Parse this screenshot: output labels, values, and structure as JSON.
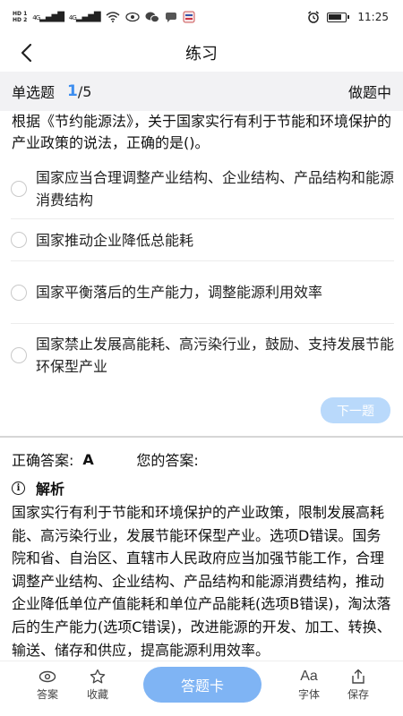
{
  "status_bar": {
    "sim1": "HD 1",
    "sim2": "HD 2",
    "signal1": "4G",
    "signal2": "4G",
    "time": "11:25"
  },
  "nav": {
    "title": "练习"
  },
  "question_header": {
    "type": "单选题",
    "current": "1",
    "total": "/5",
    "status": "做题中"
  },
  "question": {
    "text": "根据《节约能源法》，关于国家实行有利于节能和环境保护的产业政策的说法，正确的是()。",
    "options": [
      {
        "text": "国家应当合理调整产业结构、企业结构、产品结构和能源消费结构"
      },
      {
        "text": "国家推动企业降低总能耗"
      },
      {
        "text": "国家平衡落后的生产能力，调整能源利用效率"
      },
      {
        "text": "国家禁止发展高能耗、高污染行业，鼓励、支持发展节能环保型产业"
      }
    ]
  },
  "next_button": "下一题",
  "answer": {
    "correct_label": "正确答案:",
    "correct_value": "A",
    "your_label": "您的答案:"
  },
  "analysis": {
    "title": "解析",
    "text": "国家实行有利于节能和环境保护的产业政策，限制发展高耗能、高污染行业，发展节能环保型产业。选项D错误。国务院和省、自治区、直辖市人民政府应当加强节能工作，合理调整产业结构、企业结构、产品结构和能源消费结构，推动企业降低单位产值能耗和单位产品能耗(选项B错误)，淘汰落后的生产能力(选项C错误)，改进能源的开发、加工、转换、输送、储存和供应，提高能源利用效率。"
  },
  "bottom_bar": {
    "answer_label": "答案",
    "favorite_label": "收藏",
    "card_button": "答题卡",
    "font_glyph": "Aa",
    "font_label": "字体",
    "save_label": "保存"
  },
  "colors": {
    "accent": "#3d8ef0",
    "button_light": "#b9d9fb",
    "button_card": "#7fb4f4",
    "header_bg": "#f2f2f4"
  }
}
